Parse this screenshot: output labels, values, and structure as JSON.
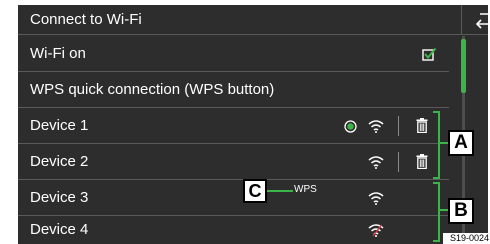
{
  "header": {
    "title": "Connect to Wi-Fi"
  },
  "settings": {
    "wifi_on_label": "Wi-Fi on",
    "wifi_on_checked": true,
    "wps_label": "WPS quick connection (WPS button)"
  },
  "devices": [
    {
      "name": "Device 1",
      "connected": true,
      "signal": "wifi-icon",
      "deletable": true
    },
    {
      "name": "Device 2",
      "connected": false,
      "signal": "wifi-icon",
      "deletable": true
    },
    {
      "name": "Device 3",
      "connected": false,
      "signal": "wifi-icon",
      "deletable": false,
      "wps": true
    },
    {
      "name": "Device 4",
      "connected": false,
      "signal": "wifi-crossed-icon",
      "deletable": false
    }
  ],
  "wps_tag": "WPS",
  "callouts": {
    "a": "A",
    "b": "B",
    "c": "C"
  },
  "image_code": "S19-0024",
  "colors": {
    "background": "#2d2d2d",
    "accent": "#3bb54a",
    "text": "#ffffff",
    "divider": "#5a5a5a"
  }
}
